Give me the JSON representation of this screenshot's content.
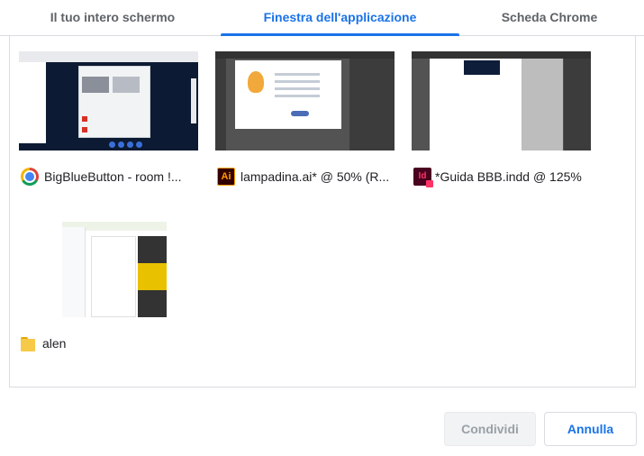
{
  "tabs": [
    {
      "label": "Il tuo intero schermo",
      "selected": false
    },
    {
      "label": "Finestra dell'applicazione",
      "selected": true
    },
    {
      "label": "Scheda Chrome",
      "selected": false
    }
  ],
  "accent_color": "#1a73e8",
  "windows": [
    {
      "label": "BigBlueButton - room !...",
      "icon": "chrome-icon"
    },
    {
      "label": "lampadina.ai* @ 50% (R...",
      "icon": "illustrator-icon",
      "icon_text": "Ai"
    },
    {
      "label": "*Guida BBB.indd @ 125%",
      "icon": "indesign-icon",
      "icon_text": "Id"
    },
    {
      "label": "alen",
      "icon": "folder-icon"
    }
  ],
  "buttons": {
    "share_label": "Condividi",
    "share_enabled": false,
    "cancel_label": "Annulla"
  }
}
